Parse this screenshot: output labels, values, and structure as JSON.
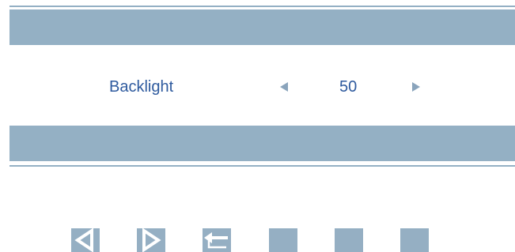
{
  "osd": {
    "setting": {
      "label": "Backlight",
      "value": "50"
    },
    "colors": {
      "bar": "#94b0c4",
      "text": "#2e5a9e",
      "arrow": "#8aa4bc"
    }
  },
  "keys": [
    {
      "icon": "left-arrow-icon"
    },
    {
      "icon": "right-arrow-icon"
    },
    {
      "icon": "return-icon"
    },
    {
      "icon": "blank-key"
    },
    {
      "icon": "blank-key"
    },
    {
      "icon": "blank-key"
    }
  ]
}
